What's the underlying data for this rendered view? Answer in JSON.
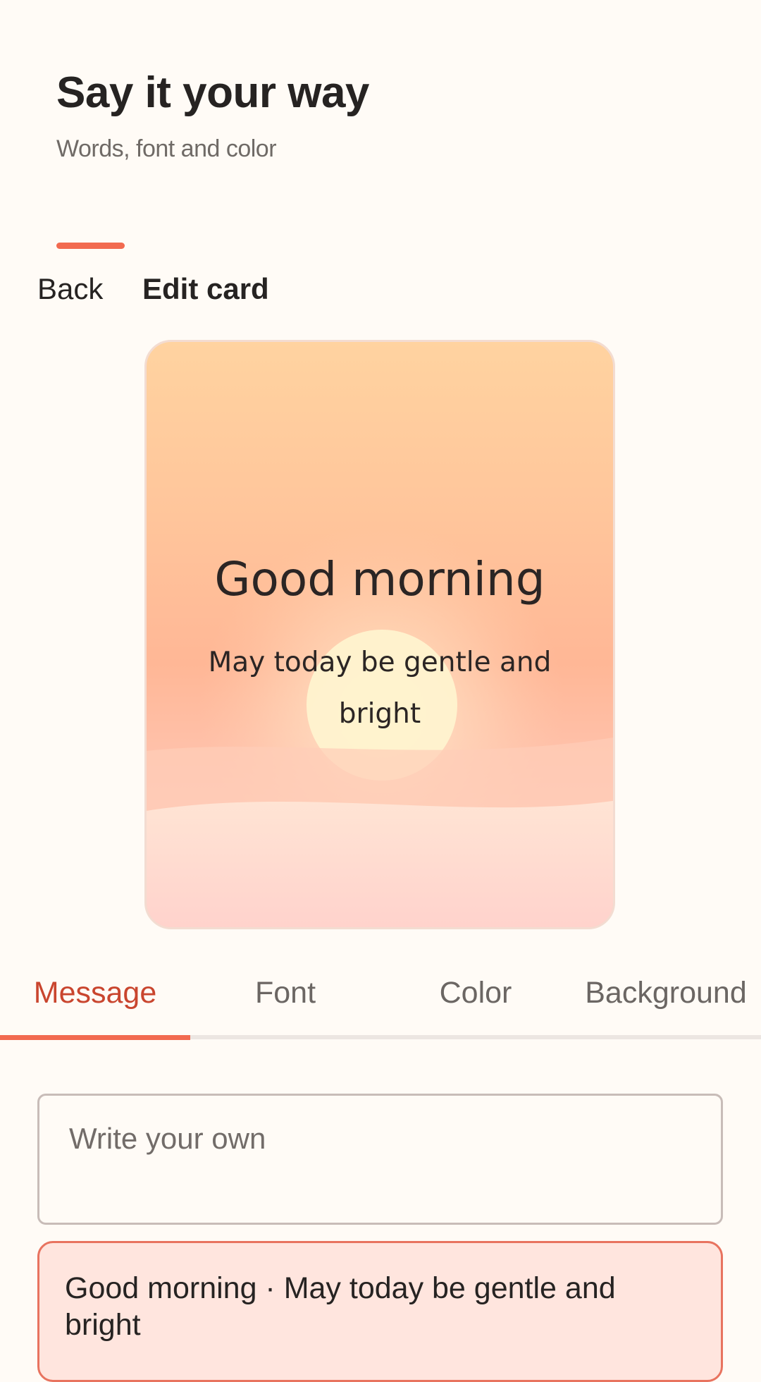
{
  "header": {
    "title": "Say it your way",
    "subtitle": "Words, font and color",
    "accent_color": "#f26a50"
  },
  "nav": {
    "back_label": "Back",
    "title": "Edit card"
  },
  "card": {
    "headline": "Good morning",
    "body": "May today be gentle and bright",
    "background": "sunrise"
  },
  "tabs": {
    "items": [
      {
        "label": "Message",
        "active": true
      },
      {
        "label": "Font",
        "active": false
      },
      {
        "label": "Color",
        "active": false
      },
      {
        "label": "Background",
        "active": false
      }
    ]
  },
  "message": {
    "input_placeholder": "Write your own",
    "input_value": "",
    "suggestion": "Good morning · May today be gentle and bright"
  }
}
